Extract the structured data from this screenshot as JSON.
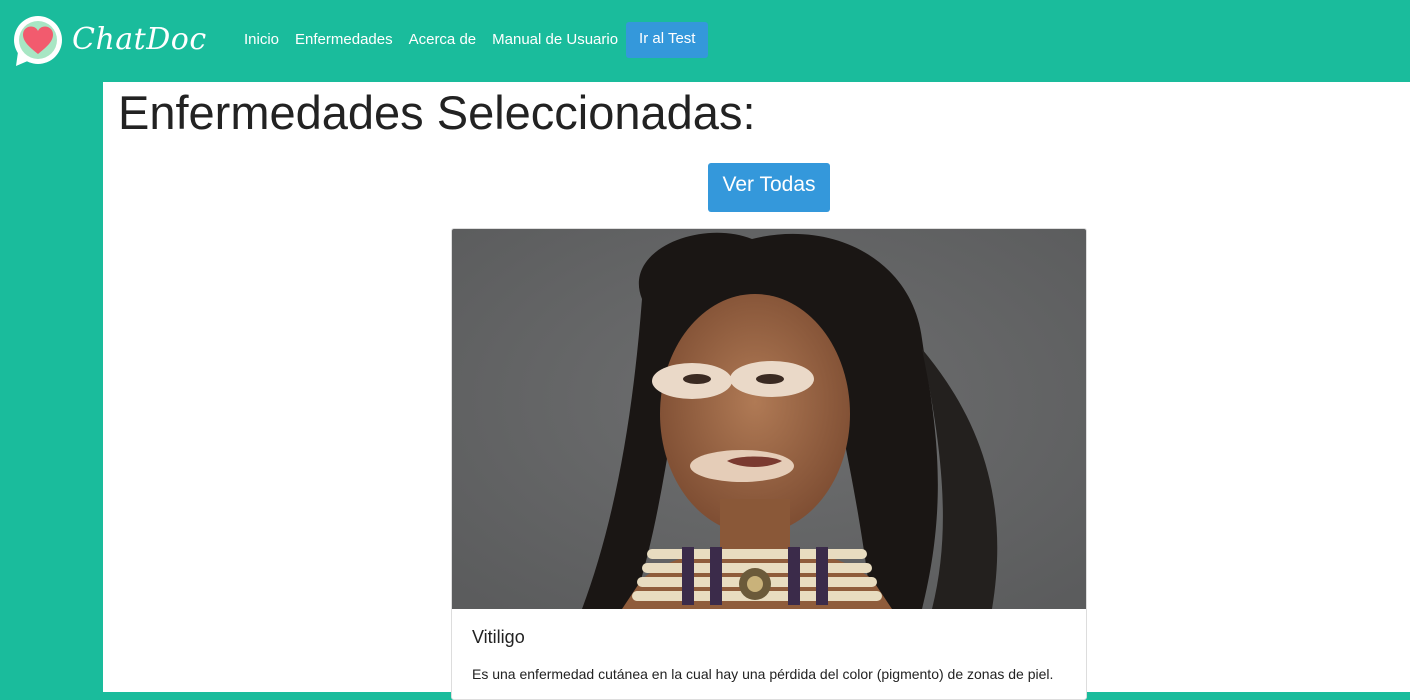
{
  "brand": {
    "name": "ChatDoc",
    "logo_icon": "heart-chat-bubble-icon"
  },
  "nav": {
    "items": [
      {
        "label": "Inicio"
      },
      {
        "label": "Enfermedades"
      },
      {
        "label": "Acerca de"
      },
      {
        "label": "Manual de Usuario"
      }
    ],
    "test_button_label": "Ir al Test"
  },
  "main": {
    "title": "Enfermedades Seleccionadas:",
    "view_all_label": "Ver Todas",
    "card": {
      "title": "Vitiligo",
      "description": "Es una enfermedad cutánea en la cual hay una pérdida del color (pigmento) de zonas de piel."
    }
  },
  "colors": {
    "primary": "#1abc9c",
    "button": "#3498db",
    "heart": "#f25b6e"
  }
}
